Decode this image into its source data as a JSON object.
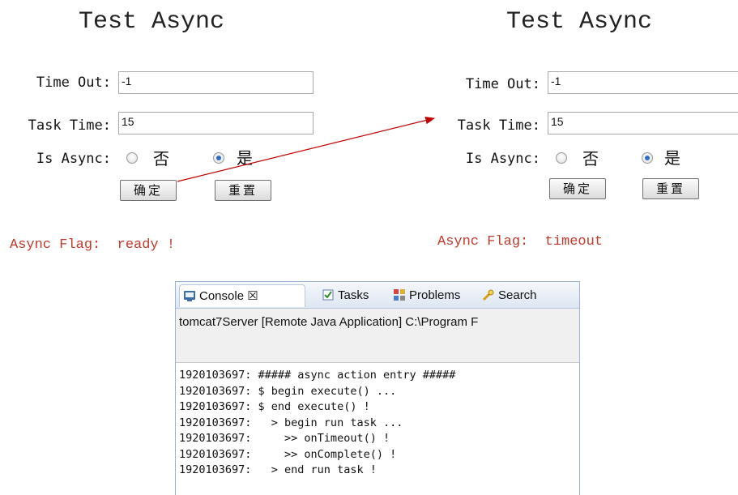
{
  "left": {
    "title": "Test Async",
    "timeout_label": "Time Out:",
    "timeout_value": "-1",
    "tasktime_label": "Task Time:",
    "tasktime_value": "15",
    "isasync_label": "Is Async:",
    "opt_no": "否",
    "opt_yes": "是",
    "selected": "是",
    "ok_label": "确定",
    "reset_label": "重置",
    "flag_label": "Async Flag:",
    "flag_value": "ready !"
  },
  "right": {
    "title": "Test Async",
    "timeout_label": "Time Out:",
    "timeout_value": "-1",
    "tasktime_label": "Task Time:",
    "tasktime_value": "15",
    "isasync_label": "Is Async:",
    "opt_no": "否",
    "opt_yes": "是",
    "selected": "是",
    "ok_label": "确定",
    "reset_label": "重置",
    "flag_label": "Async Flag:",
    "flag_value": "timeout"
  },
  "arrow_color": "#c00000",
  "console": {
    "tabs": [
      "Console ☒",
      "Tasks",
      "Problems",
      "Search"
    ],
    "description": "tomcat7Server [Remote Java Application] C:\\Program F",
    "lines": [
      "1920103697: ##### async action entry #####",
      "1920103697: $ begin execute() ...",
      "1920103697: $ end execute() !",
      "1920103697:   > begin run task ...",
      "1920103697:     >> onTimeout() !",
      "1920103697:     >> onComplete() !",
      "1920103697:   > end run task !"
    ]
  }
}
